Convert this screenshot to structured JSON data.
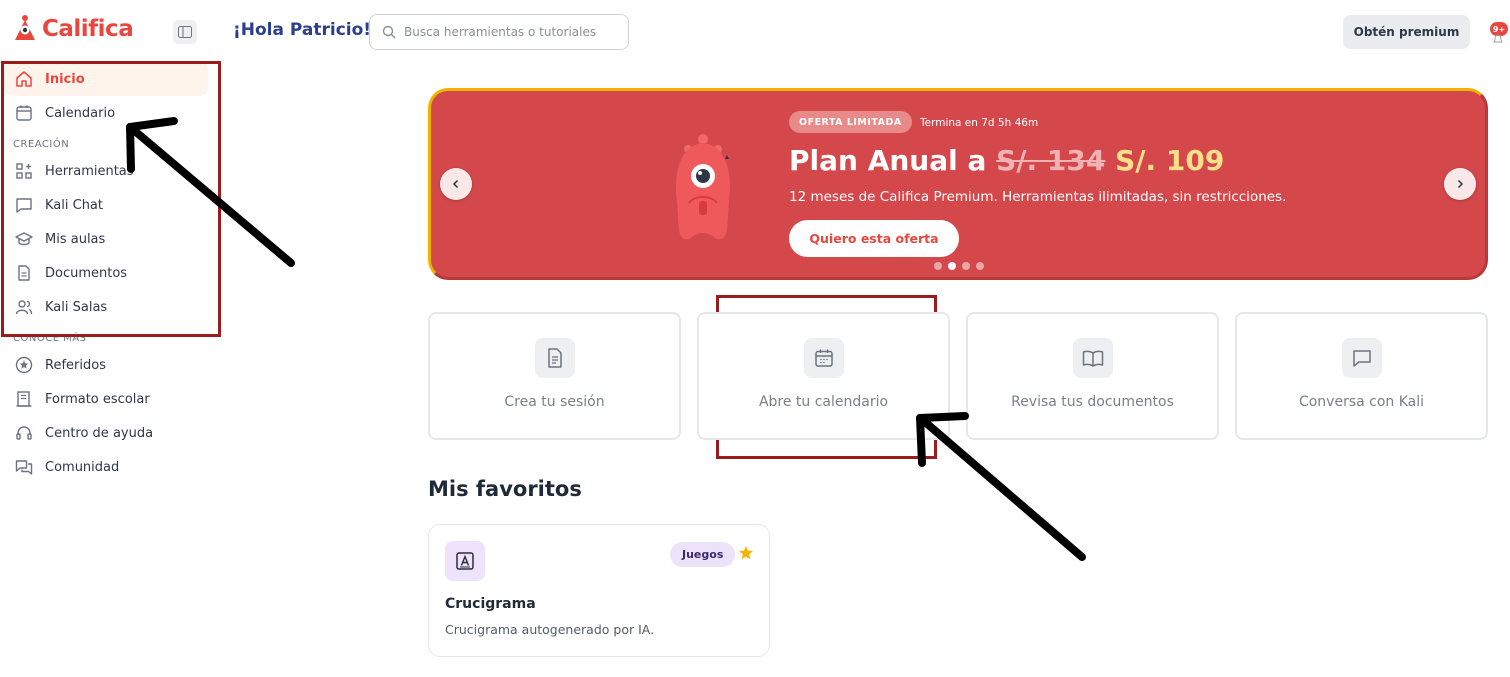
{
  "brand": {
    "name": "Califica",
    "color": "#e8473f"
  },
  "header": {
    "greeting": "¡Hola Patricio!",
    "search_placeholder": "Busca herramientas o tutoriales",
    "premium_label": "Obtén premium",
    "notification_count": "9+"
  },
  "sidebar": {
    "main": [
      {
        "label": "Inicio",
        "icon": "home-icon",
        "active": true
      },
      {
        "label": "Calendario",
        "icon": "calendar-icon"
      }
    ],
    "section_creacion": "CREACIÓN",
    "creacion": [
      {
        "label": "Herramientas",
        "icon": "grid-plus-icon"
      },
      {
        "label": "Kali Chat",
        "icon": "chat-icon"
      },
      {
        "label": "Mis aulas",
        "icon": "graduation-cap-icon"
      },
      {
        "label": "Documentos",
        "icon": "document-icon"
      },
      {
        "label": "Kali Salas",
        "icon": "users-icon"
      }
    ],
    "section_conoce": "CONOCE MÁS",
    "conoce": [
      {
        "label": "Referidos",
        "icon": "star-circle-icon"
      },
      {
        "label": "Formato escolar",
        "icon": "building-icon"
      },
      {
        "label": "Centro de ayuda",
        "icon": "headset-icon"
      },
      {
        "label": "Comunidad",
        "icon": "community-icon"
      }
    ]
  },
  "banner": {
    "badge": "OFERTA LIMITADA",
    "countdown": "Termina en 7d 5h 46m",
    "title_prefix": "Plan Anual a ",
    "old_price": "S/. 134",
    "new_price": "S/. 109",
    "description": "12 meses de Califica Premium. Herramientas ilimitadas, sin restricciones.",
    "cta": "Quiero esta oferta",
    "slides": 4,
    "active_slide": 2
  },
  "quick_actions": [
    {
      "label": "Crea tu sesión",
      "icon": "document-icon"
    },
    {
      "label": "Abre tu calendario",
      "icon": "calendar-icon"
    },
    {
      "label": "Revisa tus documentos",
      "icon": "book-open-icon"
    },
    {
      "label": "Conversa con Kali",
      "icon": "chat-icon"
    }
  ],
  "favorites": {
    "title": "Mis favoritos",
    "items": [
      {
        "name": "Crucigrama",
        "description": "Crucigrama autogenerado por IA.",
        "tag": "Juegos",
        "icon": "crossword-icon",
        "starred": true
      }
    ]
  }
}
